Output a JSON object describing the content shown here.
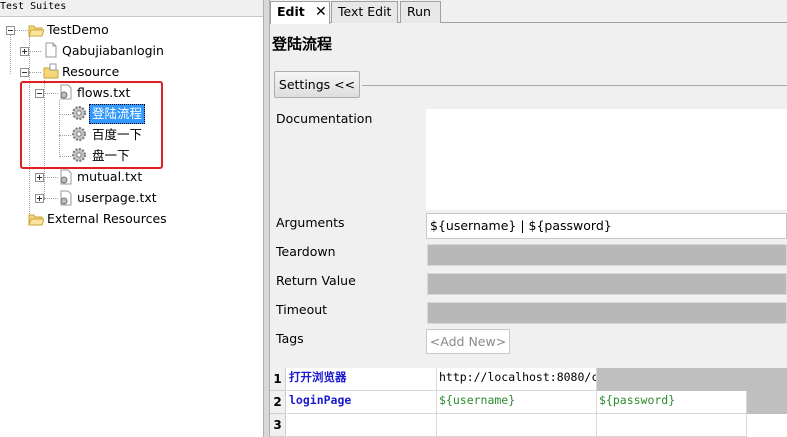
{
  "tree": {
    "header": "Test Suites",
    "items": [
      {
        "label": "TestDemo"
      },
      {
        "label": "Qabujiabanlogin"
      },
      {
        "label": "Resource"
      },
      {
        "label": "flows.txt"
      },
      {
        "label": "登陆流程"
      },
      {
        "label": "百度一下"
      },
      {
        "label": "盘一下"
      },
      {
        "label": "mutual.txt"
      },
      {
        "label": "userpage.txt"
      },
      {
        "label": "External Resources"
      }
    ]
  },
  "editor": {
    "tabs": [
      {
        "label": "Edit",
        "close": "✕"
      },
      {
        "label": "Text Edit"
      },
      {
        "label": "Run"
      }
    ],
    "title": "登陆流程",
    "settings_button": "Settings <<",
    "fields": {
      "documentation": "Documentation",
      "arguments": "Arguments",
      "arguments_value": "${username} | ${password}",
      "teardown": "Teardown",
      "return_value": "Return Value",
      "timeout": "Timeout",
      "tags": "Tags",
      "add_new": "<Add New>"
    },
    "grid": {
      "rows": [
        {
          "num": "1",
          "cells": [
            "打开浏览器",
            "http://localhost:8080/c",
            ""
          ]
        },
        {
          "num": "2",
          "cells": [
            "loginPage",
            "${username}",
            "${password}"
          ]
        },
        {
          "num": "3",
          "cells": [
            "",
            "",
            ""
          ]
        }
      ]
    }
  },
  "colors": {
    "selection": "#3399ff",
    "highlight_box": "#e02020",
    "keyword": "#1a1acc",
    "variable": "#2e8b2e"
  }
}
